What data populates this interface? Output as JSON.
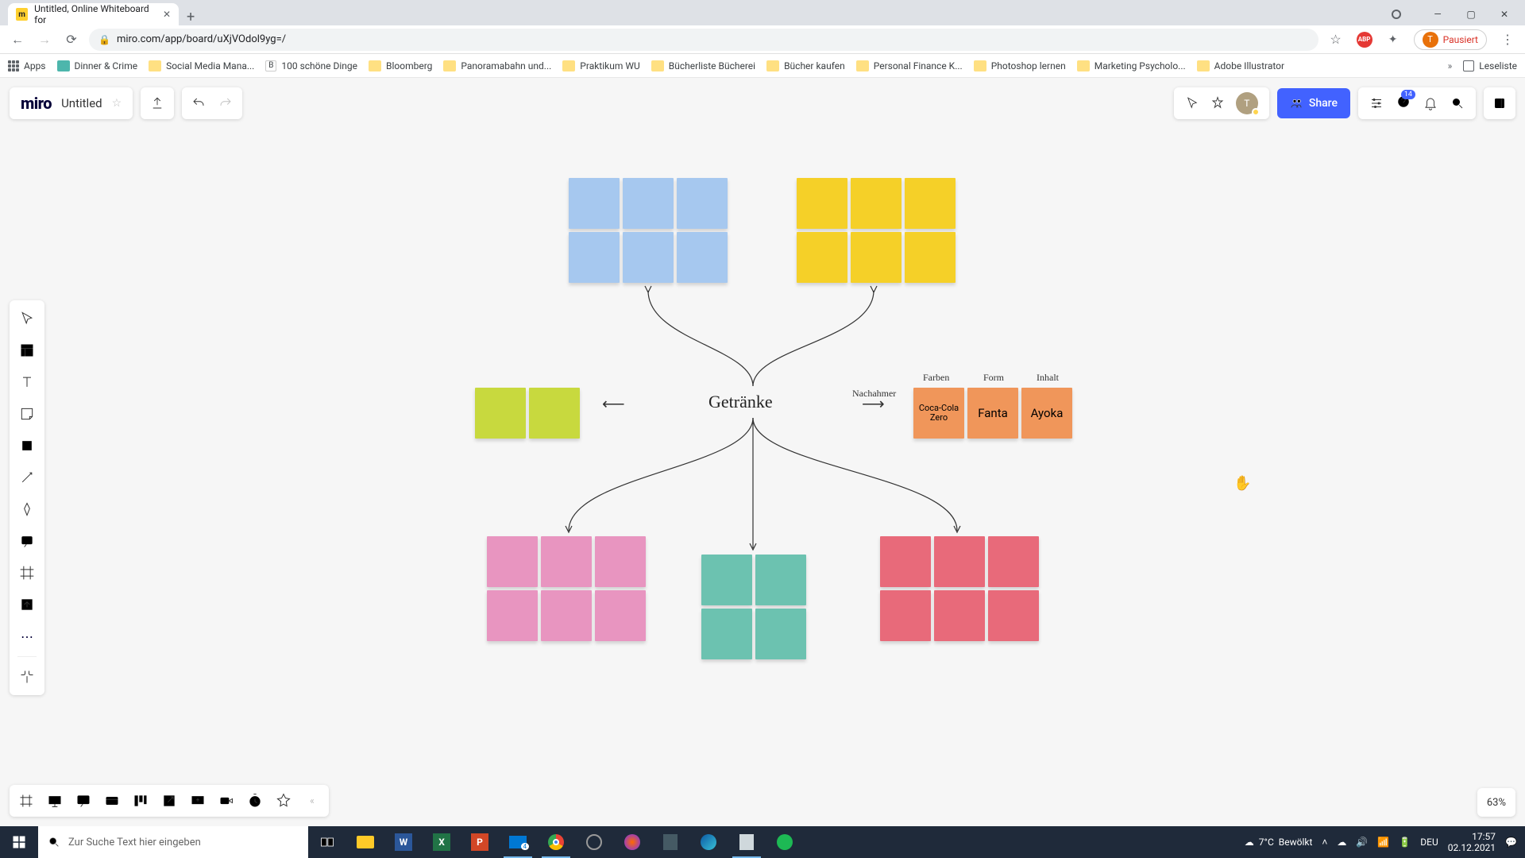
{
  "browser": {
    "tab_title": "Untitled, Online Whiteboard for",
    "url": "miro.com/app/board/uXjVOdol9yg=/",
    "extension_status": "Pausiert",
    "bookmarks": [
      "Apps",
      "Dinner & Crime",
      "Social Media Mana...",
      "100 schöne Dinge",
      "Bloomberg",
      "Panoramabahn und...",
      "Praktikum WU",
      "Bücherliste Bücherei",
      "Bücher kaufen",
      "Personal Finance K...",
      "Photoshop lernen",
      "Marketing Psycholo...",
      "Adobe Illustrator"
    ],
    "reading_list": "Leseliste"
  },
  "miro": {
    "logo": "miro",
    "board_title": "Untitled",
    "share": "Share",
    "notifications_badge": "14",
    "zoom": "63%"
  },
  "canvas": {
    "center_label": "Getränke",
    "right_subtitles": [
      "Farben",
      "Form",
      "Inhalt"
    ],
    "right_cards": [
      "Coca-Cola Zero",
      "Fanta",
      "Ayoka"
    ],
    "left_label": "Nachahmer"
  },
  "taskbar": {
    "search_placeholder": "Zur Suche Text hier eingeben",
    "weather_temp": "7°C",
    "weather_label": "Bewölkt",
    "lang": "DEU",
    "time": "17:57",
    "date": "02.12.2021"
  }
}
